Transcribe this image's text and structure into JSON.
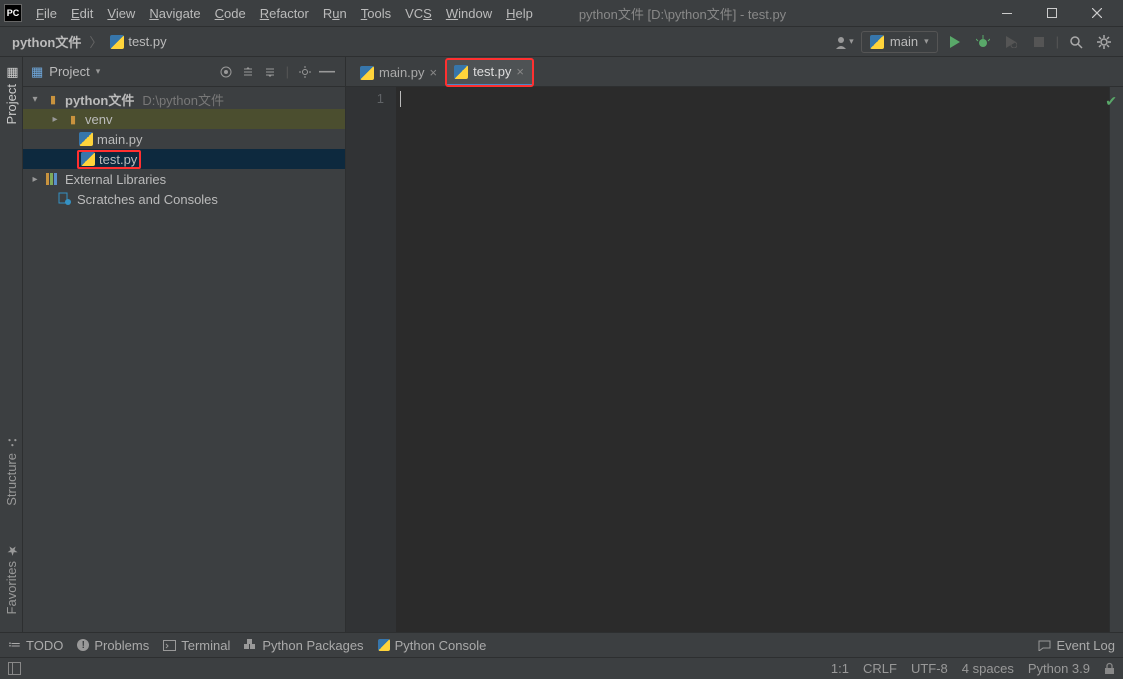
{
  "title": "python文件 [D:\\python文件] - test.py",
  "menu": [
    "File",
    "Edit",
    "View",
    "Navigate",
    "Code",
    "Refactor",
    "Run",
    "Tools",
    "VCS",
    "Window",
    "Help"
  ],
  "breadcrumb": {
    "project": "python文件",
    "file": "test.py"
  },
  "run_config": "main",
  "sidebar": {
    "title": "Project"
  },
  "tree": {
    "root": {
      "name": "python文件",
      "path": "D:\\python文件"
    },
    "venv": "venv",
    "main": "main.py",
    "test": "test.py",
    "extlib": "External Libraries",
    "scratch": "Scratches and Consoles"
  },
  "tabs": [
    {
      "name": "main.py"
    },
    {
      "name": "test.py"
    }
  ],
  "gutter": {
    "line1": "1"
  },
  "left_tabs": {
    "project": "Project",
    "structure": "Structure",
    "favorites": "Favorites"
  },
  "bottom": {
    "todo": "TODO",
    "problems": "Problems",
    "terminal": "Terminal",
    "pkg": "Python Packages",
    "console": "Python Console",
    "eventlog": "Event Log"
  },
  "status": {
    "pos": "1:1",
    "eol": "CRLF",
    "enc": "UTF-8",
    "indent": "4 spaces",
    "python": "Python 3.9"
  }
}
